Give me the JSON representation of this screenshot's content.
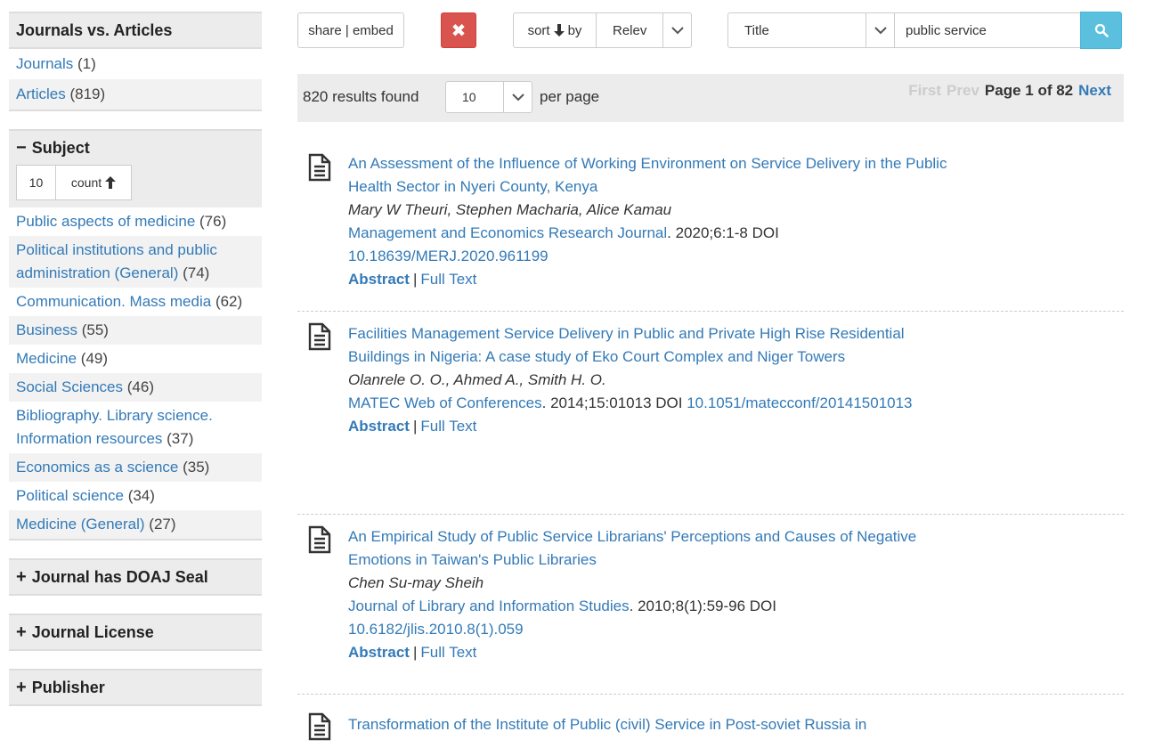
{
  "sidebar": {
    "type_facet": {
      "title": "Journals vs. Articles",
      "items": [
        {
          "label": "Journals",
          "count": "(1)"
        },
        {
          "label": "Articles",
          "count": "(819)"
        }
      ]
    },
    "subject_facet": {
      "sign": "−",
      "title": "Subject",
      "size_value": "10",
      "sort_label": "count",
      "items": [
        {
          "label": "Public aspects of medicine",
          "count": "(76)"
        },
        {
          "label": "Political institutions and public administration (General)",
          "count": "(74)"
        },
        {
          "label": "Communication. Mass media",
          "count": "(62)"
        },
        {
          "label": "Business",
          "count": "(55)"
        },
        {
          "label": "Medicine",
          "count": "(49)"
        },
        {
          "label": "Social Sciences",
          "count": "(46)"
        },
        {
          "label": "Bibliography. Library science. Information resources",
          "count": "(37)"
        },
        {
          "label": "Economics as a science",
          "count": "(35)"
        },
        {
          "label": "Political science",
          "count": "(34)"
        },
        {
          "label": "Medicine (General)",
          "count": "(27)"
        }
      ]
    },
    "closed_facets": [
      {
        "sign": "+",
        "title": "Journal has DOAJ Seal"
      },
      {
        "sign": "+",
        "title": "Journal License"
      },
      {
        "sign": "+",
        "title": "Publisher"
      }
    ]
  },
  "toolbar": {
    "share_label": "share | embed",
    "clear_label": "✖",
    "sort_label": "sort",
    "sort_by": "by",
    "sort_value": "Relev",
    "field_value": "Title",
    "search_value": "public service"
  },
  "results_bar": {
    "count_text": "820 results found",
    "per_page_value": "10",
    "per_page_label": "per page",
    "first": "First",
    "prev": "Prev",
    "page_text": "Page 1 of 82",
    "next": "Next"
  },
  "results": [
    {
      "title": "An Assessment of the Influence of Working Environment on Service Delivery in the Public Health Sector in Nyeri County, Kenya",
      "authors": "Mary W Theuri, Stephen Macharia, Alice Kamau",
      "journal": "Management and Economics Research Journal",
      "citation": ". 2020;6:1-8 DOI ",
      "doi": "10.18639/MERJ.2020.961199",
      "abstract": "Abstract",
      "fulltext": "Full Text"
    },
    {
      "title": "Facilities Management Service Delivery in Public and Private High Rise Residential Buildings in Nigeria: A case study of Eko Court Complex and Niger Towers",
      "authors": "Olanrele O. O., Ahmed A., Smith H. O.",
      "journal": "MATEC Web of Conferences",
      "citation": ". 2014;15:01013 DOI ",
      "doi": "10.1051/matecconf/20141501013",
      "abstract": "Abstract",
      "fulltext": "Full Text"
    },
    {
      "title": "An Empirical Study of Public Service Librarians' Perceptions and Causes of Negative Emotions in Taiwan's Public Libraries",
      "authors": "Chen Su-may Sheih",
      "journal": "Journal of Library and Information Studies",
      "citation": ". 2010;8(1):59-96 DOI ",
      "doi": "10.6182/jlis.2010.8(1).059",
      "abstract": "Abstract",
      "fulltext": "Full Text"
    },
    {
      "title": "Transformation of the Institute of Public (civil) Service in Post-soviet Russia in",
      "authors": "",
      "journal": "",
      "citation": "",
      "doi": "",
      "abstract": "",
      "fulltext": ""
    }
  ]
}
